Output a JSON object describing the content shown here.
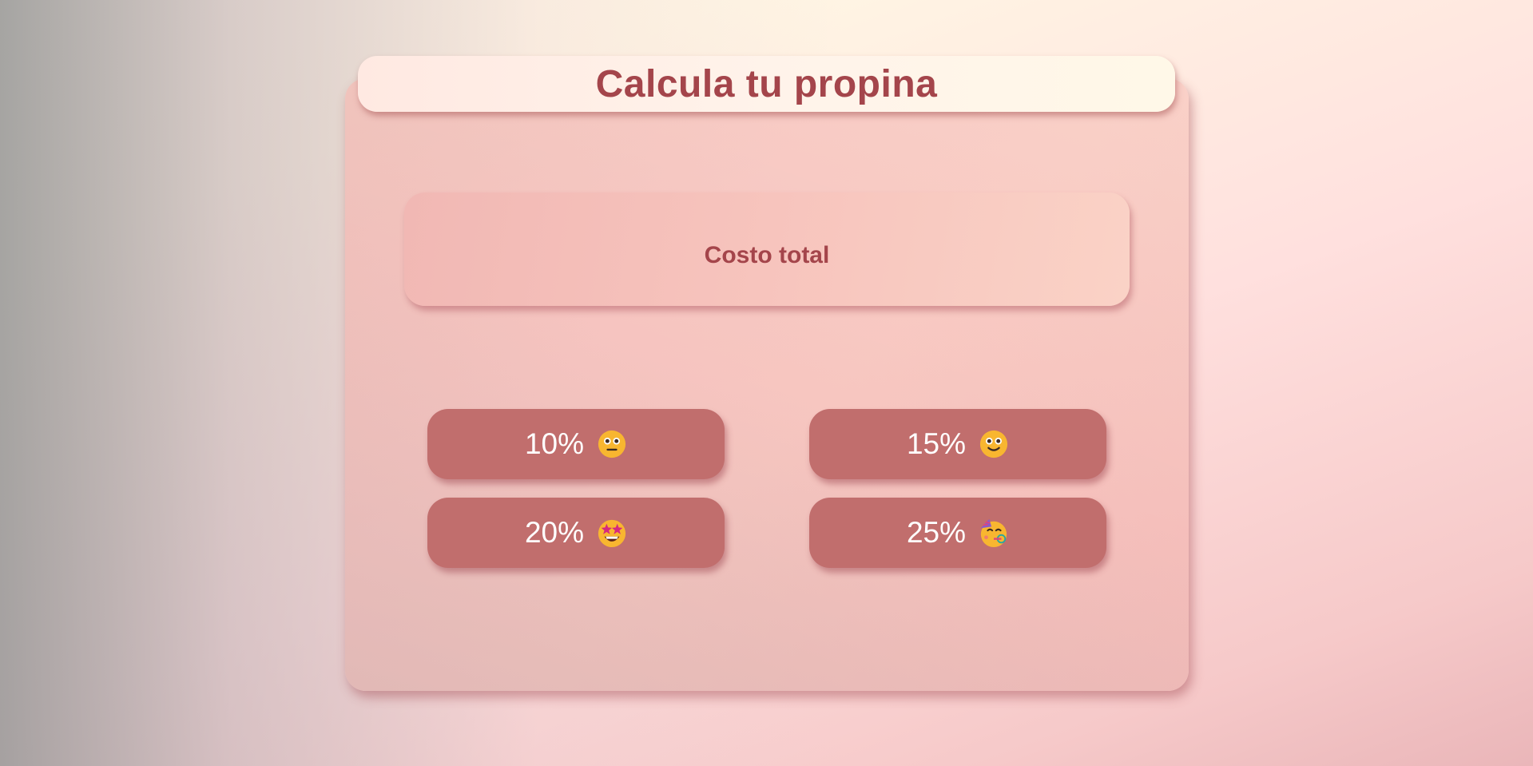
{
  "title": "Calcula tu propina",
  "total": {
    "label": "Costo total"
  },
  "tips": [
    {
      "label": "10%",
      "icon": "neutral-face-icon"
    },
    {
      "label": "15%",
      "icon": "smiling-face-icon"
    },
    {
      "label": "20%",
      "icon": "star-struck-face-icon"
    },
    {
      "label": "25%",
      "icon": "partying-face-icon"
    }
  ],
  "colors": {
    "accent": "#a4454b",
    "button": "#c16e6d",
    "button_text": "#ffffff"
  }
}
